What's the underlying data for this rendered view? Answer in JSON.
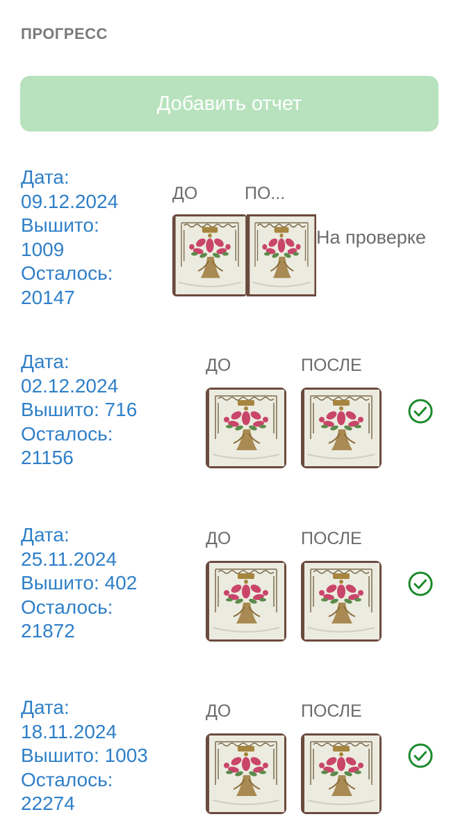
{
  "section": {
    "title": "ПРОГРЕСС"
  },
  "add_report_button": {
    "label": "Добавить отчет"
  },
  "colors": {
    "accent_text": "#2f7fc8",
    "button_bg": "#b7e2bd",
    "check": "#1a8a2a",
    "caption": "#6b6b6b"
  },
  "reports": [
    {
      "date_label": "Дата:",
      "date": "09.12.2024",
      "stitched_label": "Вышито:",
      "stitched": "1009",
      "remaining_label": "Осталось:",
      "remaining": "20147",
      "before_label": "ДО",
      "after_label": "ПО...",
      "status": "На проверке",
      "status_icon": "pending"
    },
    {
      "date_label": "Дата:",
      "date": "02.12.2024",
      "stitched_text": "Вышито: 716",
      "remaining_label": "Осталось:",
      "remaining": "21156",
      "before_label": "ДО",
      "after_label": "ПОСЛЕ",
      "status_icon": "check-circle-icon"
    },
    {
      "date_label": "Дата:",
      "date": "25.11.2024",
      "stitched_text": "Вышито: 402",
      "remaining_label": "Осталось:",
      "remaining": "21872",
      "before_label": "ДО",
      "after_label": "ПОСЛЕ",
      "status_icon": "check-circle-icon"
    },
    {
      "date_label": "Дата:",
      "date": "18.11.2024",
      "stitched_text": "Вышито: 1003",
      "remaining_label": "Осталось:",
      "remaining": "22274",
      "before_label": "ДО",
      "after_label": "ПОСЛЕ",
      "status_icon": "check-circle-icon"
    }
  ]
}
